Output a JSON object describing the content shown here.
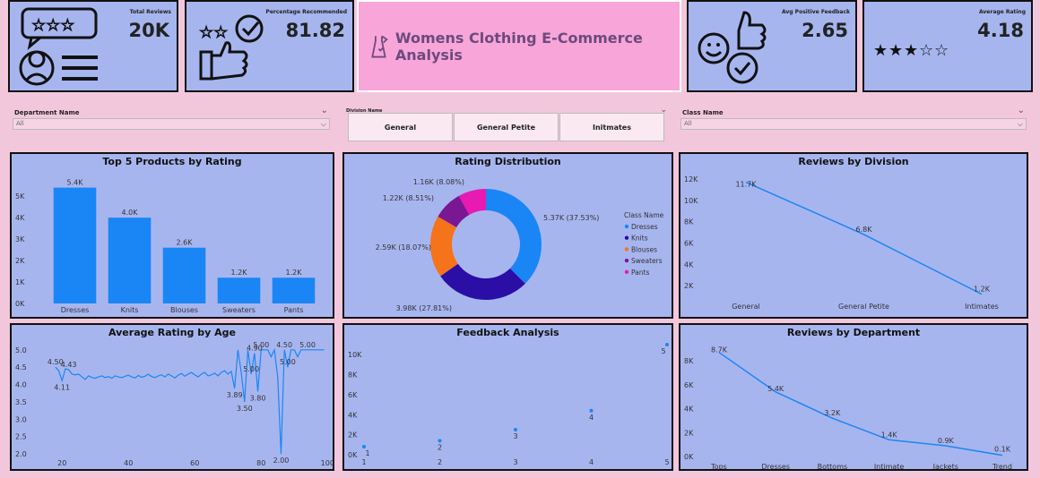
{
  "kpis": {
    "total_reviews": {
      "label": "Total Reviews",
      "value": "20K"
    },
    "pct_recommended": {
      "label": "Percentage Recommended",
      "value": "81.82"
    },
    "avg_positive_feedback": {
      "label": "Avg Positive Feedback",
      "value": "2.65"
    },
    "avg_rating": {
      "label": "Average Rating",
      "value": "4.18",
      "stars_filled": 3
    }
  },
  "header": {
    "title": "Womens Clothing E-Commerce Analysis"
  },
  "filters": {
    "department": {
      "label": "Department Name",
      "value": "All"
    },
    "division": {
      "label": "Division Name",
      "options": [
        "General",
        "General Petite",
        "Initmates"
      ]
    },
    "class_name": {
      "label": "Class Name",
      "value": "All"
    }
  },
  "colors": {
    "bar": "#1a86f5",
    "line": "#1a86f5",
    "panel": "#a7b5ef",
    "background": "#f2c7dc"
  },
  "chart_data": [
    {
      "id": "top5",
      "type": "bar",
      "title": "Top 5 Products by Rating",
      "categories": [
        "Dresses",
        "Knits",
        "Blouses",
        "Sweaters",
        "Pants"
      ],
      "values": [
        5400,
        4000,
        2600,
        1200,
        1200
      ],
      "data_labels": [
        "5.4K",
        "4.0K",
        "2.6K",
        "1.2K",
        "1.2K"
      ],
      "yticks": [
        "0K",
        "1K",
        "2K",
        "3K",
        "4K",
        "5K"
      ],
      "ylim": [
        0,
        5800
      ]
    },
    {
      "id": "rating_dist",
      "type": "pie",
      "title": "Rating Distribution",
      "legend_title": "Class Name",
      "slices": [
        {
          "name": "Dresses",
          "value": 5370,
          "label": "5.37K (37.53%)",
          "color": "#1a86f5"
        },
        {
          "name": "Knits",
          "value": 3980,
          "label": "3.98K (27.81%)",
          "color": "#2a0ea6"
        },
        {
          "name": "Blouses",
          "value": 2590,
          "label": "2.59K (18.07%)",
          "color": "#f5731a"
        },
        {
          "name": "Sweaters",
          "value": 1220,
          "label": "1.22K (8.51%)",
          "color": "#7a1793"
        },
        {
          "name": "Pants",
          "value": 1160,
          "label": "1.16K (8.08%)",
          "color": "#e81ab2"
        }
      ]
    },
    {
      "id": "reviews_division",
      "type": "line",
      "title": "Reviews by Division",
      "categories": [
        "General",
        "General Petite",
        "Intimates"
      ],
      "values": [
        11700,
        6800,
        1200
      ],
      "data_labels": [
        "11.7K",
        "6.8K",
        "1.2K"
      ],
      "yticks": [
        "2K",
        "4K",
        "6K",
        "8K",
        "10K",
        "12K"
      ],
      "ylim": [
        1000,
        12500
      ]
    },
    {
      "id": "avg_rating_age",
      "type": "line",
      "title": "Average Rating by Age",
      "x": [
        18,
        19,
        20,
        21,
        22,
        23,
        24,
        25,
        26,
        27,
        28,
        29,
        30,
        31,
        32,
        33,
        34,
        35,
        36,
        37,
        38,
        39,
        40,
        41,
        42,
        43,
        44,
        45,
        46,
        47,
        48,
        49,
        50,
        51,
        52,
        53,
        54,
        55,
        56,
        57,
        58,
        59,
        60,
        61,
        62,
        63,
        64,
        65,
        66,
        67,
        68,
        69,
        70,
        71,
        72,
        73,
        74,
        75,
        76,
        77,
        78,
        79,
        80,
        81,
        82,
        83,
        84,
        85,
        86,
        87,
        88,
        89,
        90,
        91,
        92,
        93,
        94,
        95,
        96,
        97,
        98,
        99
      ],
      "y": [
        4.5,
        4.4,
        4.11,
        4.45,
        4.43,
        4.3,
        4.28,
        4.3,
        4.22,
        4.15,
        4.25,
        4.2,
        4.18,
        4.22,
        4.25,
        4.2,
        4.23,
        4.18,
        4.25,
        4.22,
        4.2,
        4.24,
        4.27,
        4.22,
        4.19,
        4.26,
        4.21,
        4.24,
        4.3,
        4.23,
        4.2,
        4.25,
        4.28,
        4.22,
        4.3,
        4.25,
        4.19,
        4.27,
        4.32,
        4.24,
        4.3,
        4.35,
        4.28,
        4.22,
        4.3,
        4.35,
        4.25,
        4.28,
        4.33,
        4.25,
        4.35,
        4.4,
        4.3,
        4.38,
        3.89,
        5.0,
        4.35,
        3.5,
        5.0,
        4.3,
        4.9,
        3.8,
        5.0,
        5.0,
        5.0,
        4.8,
        5.0,
        4.2,
        2.0,
        5.0,
        4.5,
        5.0,
        5.0,
        4.8,
        5.0,
        5.0,
        5.0,
        5.0,
        5.0,
        5.0,
        5.0,
        5.0
      ],
      "data_labels": [
        {
          "x": 18,
          "label": "4.50"
        },
        {
          "x": 20,
          "label": "4.11"
        },
        {
          "x": 22,
          "label": "4.43"
        },
        {
          "x": 72,
          "label": "3.89"
        },
        {
          "x": 75,
          "label": "3.50"
        },
        {
          "x": 77,
          "label": "5.00"
        },
        {
          "x": 78,
          "label": "4.90"
        },
        {
          "x": 79,
          "label": "3.80"
        },
        {
          "x": 80,
          "label": "5.00"
        },
        {
          "x": 86,
          "label": "2.00"
        },
        {
          "x": 87,
          "label": "4.50"
        },
        {
          "x": 88,
          "label": "5.00"
        },
        {
          "x": 94,
          "label": "5.00"
        }
      ],
      "xticks": [
        20,
        40,
        60,
        80,
        100
      ],
      "yticks": [
        2.0,
        2.5,
        3.0,
        3.5,
        4.0,
        4.5,
        5.0
      ],
      "xlim": [
        14,
        101
      ],
      "ylim": [
        1.9,
        5.15
      ]
    },
    {
      "id": "feedback",
      "type": "scatter",
      "title": "Feedback Analysis",
      "points": [
        {
          "x": 1,
          "y": 800,
          "label": "1"
        },
        {
          "x": 2,
          "y": 1400,
          "label": "2"
        },
        {
          "x": 3,
          "y": 2500,
          "label": "3"
        },
        {
          "x": 4,
          "y": 4400,
          "label": "4"
        },
        {
          "x": 5,
          "y": 11000,
          "label": "5"
        }
      ],
      "xticks": [
        1,
        2,
        3,
        4,
        5
      ],
      "yticks": [
        "0K",
        "2K",
        "4K",
        "6K",
        "8K",
        "10K"
      ],
      "xlim": [
        1,
        5
      ],
      "ylim": [
        0,
        11000
      ]
    },
    {
      "id": "reviews_department",
      "type": "line",
      "title": "Reviews by Department",
      "categories": [
        "Tops",
        "Dresses",
        "Bottoms",
        "Intimate",
        "Jackets",
        "Trend"
      ],
      "values": [
        8700,
        5400,
        3200,
        1400,
        900,
        100
      ],
      "data_labels": [
        "8.7K",
        "5.4K",
        "3.2K",
        "1.4K",
        "0.9K",
        "0.1K"
      ],
      "yticks": [
        "0K",
        "2K",
        "4K",
        "6K",
        "8K"
      ],
      "ylim": [
        0,
        9200
      ]
    }
  ]
}
